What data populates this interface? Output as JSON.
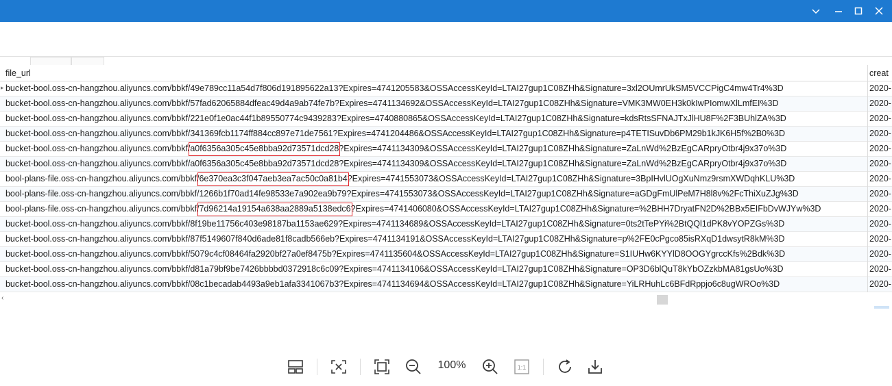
{
  "table": {
    "columns": [
      "file_url",
      "creat"
    ],
    "rows": [
      {
        "file_url": "bucket-bool.oss-cn-hangzhou.aliyuncs.com/bbkf/49e789cc11a54d7f806d191895622a13?Expires=4741205583&OSSAccessKeyId=LTAI27gup1C08ZHh&Signature=3xl2OUmrUkSM5VCCPigC4mw4Tr4%3D",
        "create": "2020-"
      },
      {
        "file_url": "bucket-bool.oss-cn-hangzhou.aliyuncs.com/bbkf/57fad62065884dfeac49d4a9ab74fe7b?Expires=4741134692&OSSAccessKeyId=LTAI27gup1C08ZHh&Signature=VMK3MW0EH3k0kIwPIomwXlLmfEI%3D",
        "create": "2020-"
      },
      {
        "file_url": "bucket-bool.oss-cn-hangzhou.aliyuncs.com/bbkf/221e0f1e0ac44f1b89550774c9439283?Expires=4740880865&OSSAccessKeyId=LTAI27gup1C08ZHh&Signature=kdsRtsSFNAJTxJlHU8F%2F3BUhlZA%3D",
        "create": "2020-"
      },
      {
        "file_url": "bucket-bool.oss-cn-hangzhou.aliyuncs.com/bbkf/341369fcb1174ff884cc897e71de7561?Expires=4741204486&OSSAccessKeyId=LTAI27gup1C08ZHh&Signature=p4TETISuvDb6PM29b1kJK6H5f%2B0%3D",
        "create": "2020-"
      },
      {
        "file_url": "bucket-bool.oss-cn-hangzhou.aliyuncs.com/bbkf/a0f6356a305c45e8bba92d73571dcd28?Expires=4741134309&OSSAccessKeyId=LTAI27gup1C08ZHh&Signature=ZaLnWd%2BzEgCARpryOtbr4j9x37o%3D",
        "create": "2020-"
      },
      {
        "file_url": "bucket-bool.oss-cn-hangzhou.aliyuncs.com/bbkf/a0f6356a305c45e8bba92d73571dcd28?Expires=4741134309&OSSAccessKeyId=LTAI27gup1C08ZHh&Signature=ZaLnWd%2BzEgCARpryOtbr4j9x37o%3D",
        "create": "2020-"
      },
      {
        "file_url": "bool-plans-file.oss-cn-hangzhou.aliyuncs.com/bbkf/6e370ea3c3f047aeb3ea7ac50c0a81b4?Expires=4741553073&OSSAccessKeyId=LTAI27gup1C08ZHh&Signature=3BpIHvlUOgXuNmz9rsmXWDqhKLU%3D",
        "create": "2020-"
      },
      {
        "file_url": "bool-plans-file.oss-cn-hangzhou.aliyuncs.com/bbkf/1266b1f70ad14fe98533e7a902ea9b79?Expires=4741553073&OSSAccessKeyId=LTAI27gup1C08ZHh&Signature=aGDgFmUlPeM7H8l8v%2FcThiXuZJg%3D",
        "create": "2020-"
      },
      {
        "file_url": "bool-plans-file.oss-cn-hangzhou.aliyuncs.com/bbkf/7d96214a19154a638aa2889a5138edc6?Expires=4741406080&OSSAccessKeyId=LTAI27gup1C08ZHh&Signature=%2BHH7DryatFN2D%2BBx5EIFbDvWJYw%3D",
        "create": "2020-"
      },
      {
        "file_url": "bucket-bool.oss-cn-hangzhou.aliyuncs.com/bbkf/8f19be11756c403e98187ba1153ae629?Expires=4741134689&OSSAccessKeyId=LTAI27gup1C08ZHh&Signature=0ts2tTePYi%2BtQQl1dPK8vYOPZGs%3D",
        "create": "2020-"
      },
      {
        "file_url": "bucket-bool.oss-cn-hangzhou.aliyuncs.com/bbkf/87f5149607f840d6ade81f8cadb566eb?Expires=4741134191&OSSAccessKeyId=LTAI27gup1C08ZHh&Signature=p%2FE0cPgco85isRXqD1dwsytR8kM%3D",
        "create": "2020-"
      },
      {
        "file_url": "bucket-bool.oss-cn-hangzhou.aliyuncs.com/bbkf/5079c4cf08464fa2920bf27a0ef8475b?Expires=4741135604&OSSAccessKeyId=LTAI27gup1C08ZHh&Signature=S1IUHw6KYYlD8OOGYgrccKfs%2Bdk%3D",
        "create": "2020-"
      },
      {
        "file_url": "bucket-bool.oss-cn-hangzhou.aliyuncs.com/bbkf/d81a79bf9be7426bbbbd0372918c6c09?Expires=4741134106&OSSAccessKeyId=LTAI27gup1C08ZHh&Signature=OP3D6blQuT8kYbOZzkbMA81gsUo%3D",
        "create": "2020-"
      },
      {
        "file_url": "bucket-bool.oss-cn-hangzhou.aliyuncs.com/bbkf/08c1becadab4493a9eb1afa3341067b3?Expires=4741134694&OSSAccessKeyId=LTAI27gup1C08ZHh&Signature=YiLRHuhLc6BFdRppjo6c8ugWROo%3D",
        "create": "2020-"
      }
    ]
  },
  "toolbar": {
    "zoom": "100%",
    "one_to_one": "1:1",
    "icons": [
      "thumbnails-icon",
      "fit-window-icon",
      "fullscreen-icon",
      "zoom-out-icon",
      "zoom-in-icon",
      "actual-size-icon",
      "rotate-icon",
      "download-icon"
    ]
  },
  "window_controls": [
    "collapse-chevron-icon",
    "minimize-icon",
    "maximize-icon",
    "close-icon"
  ],
  "colors": {
    "titlebar": "#1e7ad1",
    "highlight_box": "#e0242a"
  }
}
